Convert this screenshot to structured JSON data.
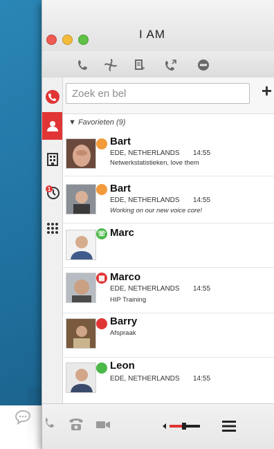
{
  "window": {
    "title": "I AM"
  },
  "toolbar": {
    "items": [
      {
        "icon": "phone-settings-icon"
      },
      {
        "icon": "fan-icon"
      },
      {
        "icon": "note-add-icon"
      },
      {
        "icon": "forward-call-icon"
      },
      {
        "icon": "do-not-disturb-icon"
      }
    ]
  },
  "sidebar": {
    "items": [
      {
        "icon": "phone-icon",
        "active": false
      },
      {
        "icon": "person-icon",
        "active": true
      },
      {
        "icon": "building-icon",
        "active": false
      },
      {
        "icon": "history-icon",
        "active": false,
        "badge": "1"
      },
      {
        "icon": "keypad-icon",
        "active": false
      }
    ]
  },
  "search": {
    "placeholder": "Zoek en bel",
    "add_label": "+"
  },
  "favorites": {
    "header": "Favorieten (9)"
  },
  "contacts": [
    {
      "name": "Bart",
      "location": "EDE, NETHERLANDS",
      "time": "14:55",
      "note": "Netwerkstatistieken, love them",
      "status_color": "#f39a3a",
      "status_symbol": ""
    },
    {
      "name": "Bart",
      "location": "EDE, NETHERLANDS",
      "time": "14:55",
      "note": "Working on our new voice core!",
      "status_color": "#f39a3a",
      "status_symbol": ""
    },
    {
      "name": "Marc",
      "location": "",
      "time": "",
      "note": "",
      "status_color": "#4cb848",
      "status_symbol": "☏"
    },
    {
      "name": "Marco",
      "location": "EDE, NETHERLANDS",
      "time": "14:55",
      "note": "HIP Training",
      "status_color": "#e13535",
      "status_symbol": "▦"
    },
    {
      "name": "Barry",
      "location": "",
      "time": "",
      "note": "Afspraak",
      "status_color": "#e13535",
      "status_symbol": ""
    },
    {
      "name": "Leon",
      "location": "EDE, NETHERLANDS",
      "time": "14:55",
      "note": "",
      "status_color": "#4cb848",
      "status_symbol": ""
    }
  ],
  "bottombar": {
    "items": [
      {
        "icon": "chat-icon"
      },
      {
        "icon": "phone-icon"
      },
      {
        "icon": "desk-phone-icon"
      },
      {
        "icon": "video-icon"
      },
      {
        "icon": "volume-icon"
      },
      {
        "icon": "menu-icon"
      }
    ]
  },
  "colors": {
    "accent": "#e13535",
    "background": "#1f6f9d"
  }
}
